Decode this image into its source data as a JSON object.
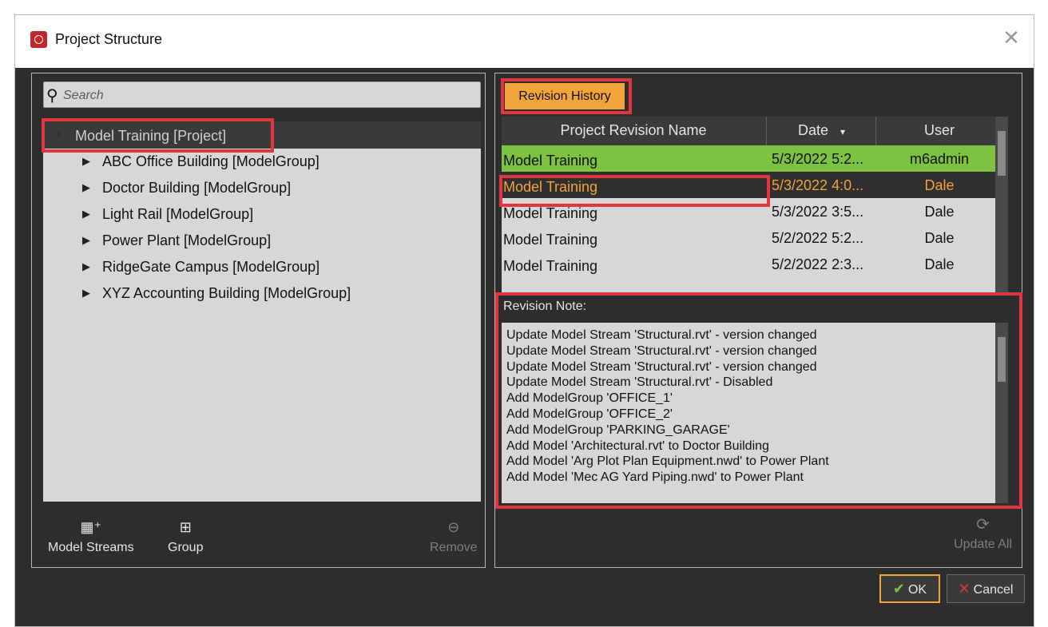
{
  "window": {
    "title": "Project Structure",
    "close_glyph": "✕"
  },
  "search": {
    "placeholder": "Search"
  },
  "tree": {
    "root": "Model Training [Project]",
    "items": [
      "ABC Office Building [ModelGroup]",
      "Doctor Building [ModelGroup]",
      "Light Rail [ModelGroup]",
      "Power Plant [ModelGroup]",
      "RidgeGate Campus [ModelGroup]",
      "XYZ Accounting Building [ModelGroup]"
    ]
  },
  "left_actions": {
    "model_streams": "Model Streams",
    "group": "Group",
    "remove": "Remove"
  },
  "revision": {
    "tab_label": "Revision History",
    "columns": {
      "name": "Project Revision Name",
      "date": "Date",
      "user": "User"
    },
    "rows": [
      {
        "name": "Model Training",
        "date": "5/3/2022 5:2...",
        "user": "m6admin"
      },
      {
        "name": "Model Training",
        "date": "5/3/2022 4:0...",
        "user": "Dale"
      },
      {
        "name": "Model Training",
        "date": "5/3/2022 3:5...",
        "user": "Dale"
      },
      {
        "name": "Model Training",
        "date": "5/2/2022 5:2...",
        "user": "Dale"
      },
      {
        "name": "Model Training",
        "date": "5/2/2022 2:3...",
        "user": "Dale"
      }
    ],
    "note_label": "Revision Note:",
    "note_lines": [
      "Update Model Stream 'Structural.rvt' - version changed",
      "Update Model Stream 'Structural.rvt' - version changed",
      "Update Model Stream 'Structural.rvt' - version changed",
      "Update Model Stream 'Structural.rvt' - Disabled",
      "Add ModelGroup 'OFFICE_1'",
      "Add ModelGroup 'OFFICE_2'",
      "Add ModelGroup 'PARKING_GARAGE'",
      "Add Model 'Architectural.rvt' to Doctor Building",
      "Add Model 'Arg Plot Plan Equipment.nwd' to Power Plant",
      "Add Model 'Mec AG Yard Piping.nwd' to Power Plant"
    ],
    "update_all": "Update All"
  },
  "footer": {
    "ok": "OK",
    "cancel": "Cancel"
  },
  "colors": {
    "accent": "#f2a33a",
    "selected_row": "#7dc241",
    "highlight_box": "#e2353f"
  }
}
